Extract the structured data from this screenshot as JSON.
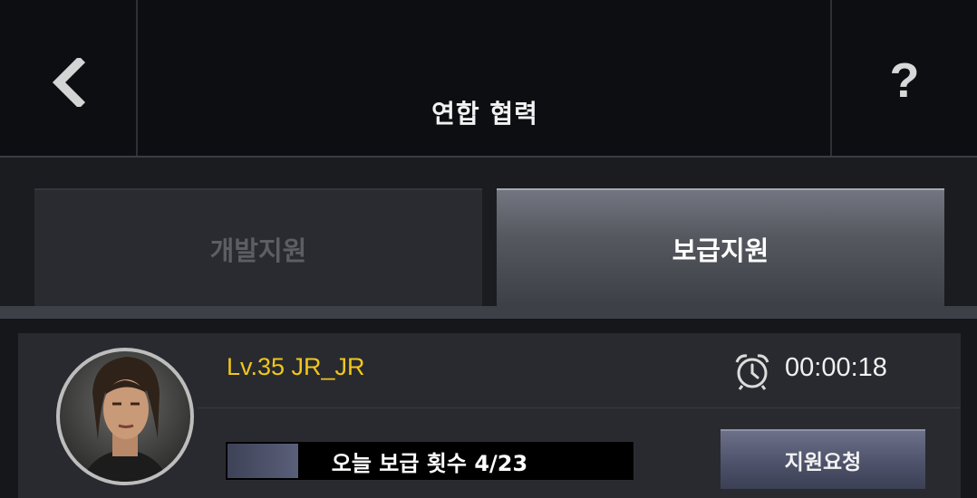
{
  "header": {
    "title": "연합 협력",
    "back_icon": "chevron-left-icon",
    "help_label": "?"
  },
  "tabs": [
    {
      "label": "개발지원",
      "active": false
    },
    {
      "label": "보급지원",
      "active": true
    }
  ],
  "member": {
    "name": "Lv.35 JR_JR",
    "timer": "00:00:18",
    "timer_icon": "alarm-clock-icon",
    "progress_text": "오늘 보급 횟수 4/23",
    "progress_fraction": 0.174,
    "request_label": "지원요청"
  },
  "colors": {
    "name": "#f0c61c",
    "active_tab": "#55585f",
    "button": "#4e526a"
  }
}
